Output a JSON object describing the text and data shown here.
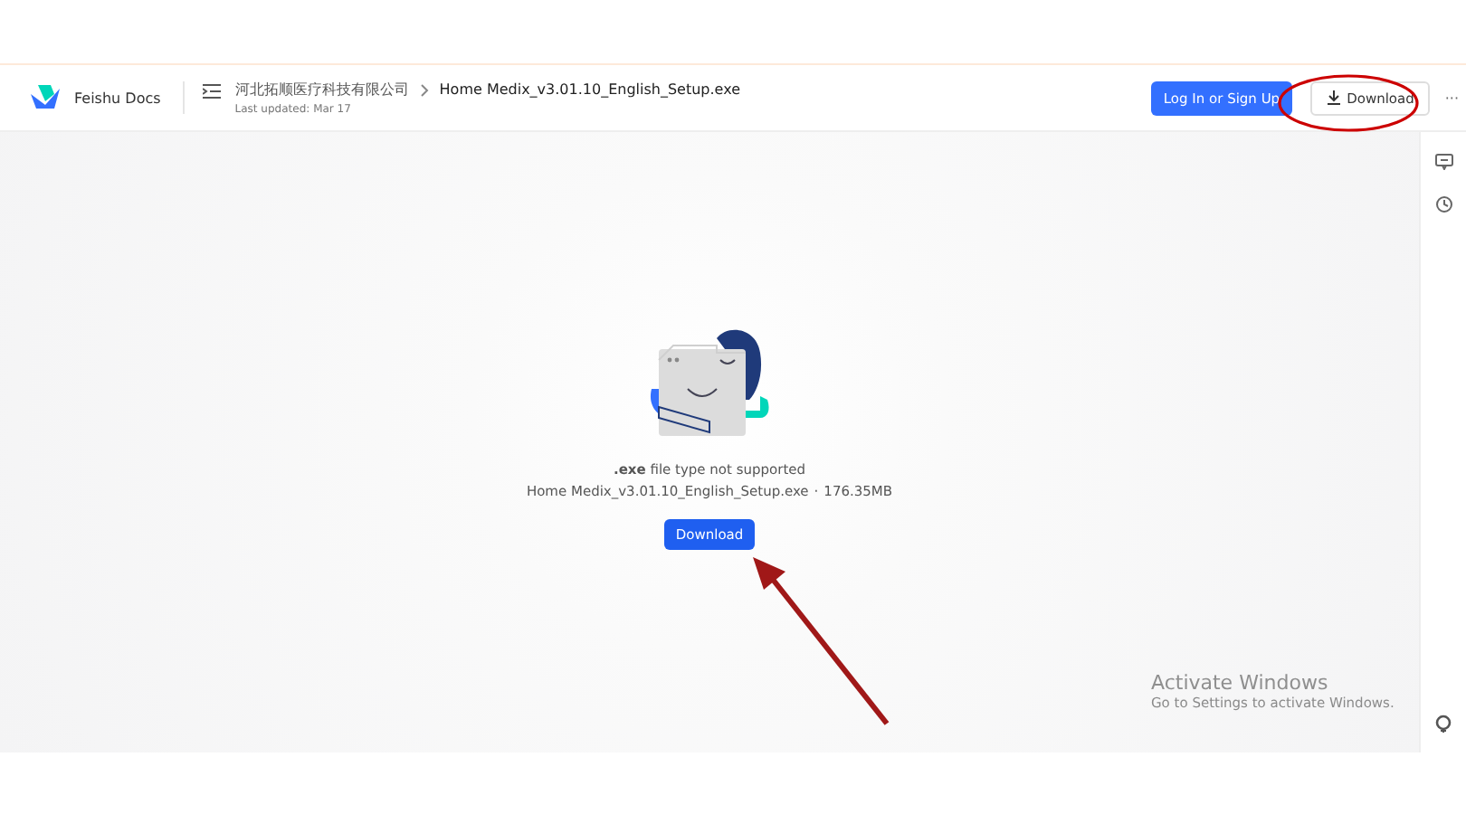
{
  "header": {
    "product": "Feishu Docs",
    "breadcrumb": [
      {
        "label": "河北拓顺医疗科技有限公司"
      },
      {
        "label": "Home Medix_v3.01.10_English_Setup.exe"
      }
    ],
    "last_updated": "Last updated: Mar 17",
    "login_button": "Log In or Sign Up",
    "download_button": "Download",
    "more": "···"
  },
  "preview": {
    "message": "**.exe** file type not supported",
    "file_name": "Home Medix_v3.01.10_English_Setup.exe",
    "separator": "·",
    "file_size": "176.35MB",
    "download_button": "Download"
  },
  "watermark_notice": {
    "title": "Activate Windows",
    "subtitle": "Go to Settings to activate Windows."
  }
}
